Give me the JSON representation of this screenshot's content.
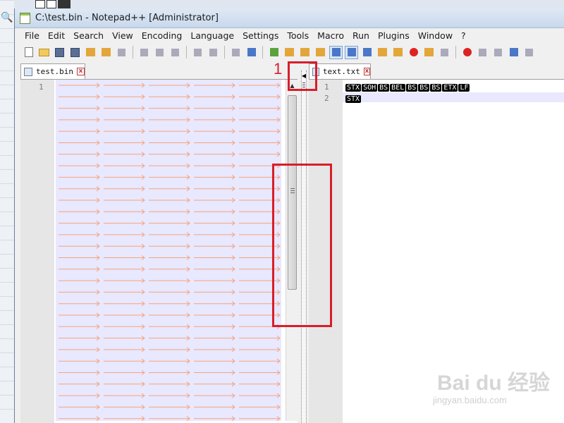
{
  "window": {
    "title": "C:\\test.bin - Notepad++ [Administrator]"
  },
  "menu": [
    "File",
    "Edit",
    "Search",
    "View",
    "Encoding",
    "Language",
    "Settings",
    "Tools",
    "Macro",
    "Run",
    "Plugins",
    "Window",
    "?"
  ],
  "toolbar": {
    "icons": [
      "new-file-icon",
      "open-folder-icon",
      "save-icon",
      "save-all-icon",
      "close-icon",
      "close-all-icon",
      "print-icon",
      "cut-icon",
      "copy-icon",
      "paste-icon",
      "undo-icon",
      "redo-icon",
      "find-icon",
      "replace-icon",
      "zoom-in-icon",
      "zoom-out-icon",
      "sync-vertical-icon",
      "sync-horizontal-icon",
      "word-wrap-icon",
      "show-all-chars-icon",
      "indent-guide-icon",
      "user-define-icon",
      "doc-map-icon",
      "function-list-icon",
      "folder-workspace-icon",
      "monitoring-icon",
      "record-macro-icon",
      "stop-macro-icon",
      "play-macro-icon",
      "run-macro-multiple-icon",
      "save-macro-icon"
    ]
  },
  "left_pane": {
    "tab_label": "test.bin",
    "line_number": "1"
  },
  "right_pane": {
    "tab_label": "text.txt",
    "line_numbers": [
      "1",
      "2"
    ],
    "line1_tokens": [
      "STX",
      "SOH",
      "BS",
      "BEL",
      "BS",
      "BS",
      "BS",
      "ETX",
      "LF"
    ],
    "line2_tokens": [
      "STX"
    ]
  },
  "annotation": {
    "number": "1",
    "color": "#d81e2a"
  },
  "watermark": {
    "brand": "Bai du 经验",
    "url": "jingyan.baidu.com"
  }
}
